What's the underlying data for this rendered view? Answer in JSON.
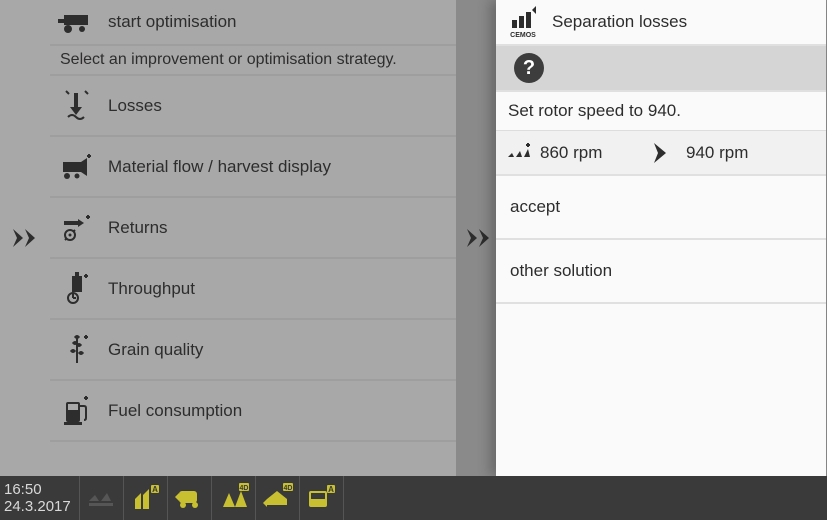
{
  "left": {
    "header_label": "start optimisation",
    "instruction": "Select an improvement or optimisation strategy.",
    "items": [
      {
        "label": "Losses"
      },
      {
        "label": "Material flow / harvest display"
      },
      {
        "label": "Returns"
      },
      {
        "label": "Throughput"
      },
      {
        "label": "Grain quality"
      },
      {
        "label": "Fuel consumption"
      }
    ]
  },
  "right": {
    "header_label": "Separation losses",
    "header_sub": "CEMOS",
    "instruction": "Set rotor speed to 940.",
    "rpm_current": "860 rpm",
    "rpm_target": "940 rpm",
    "actions": {
      "accept": "accept",
      "other": "other solution"
    }
  },
  "bottombar": {
    "time": "16:50",
    "date": "24.3.2017"
  },
  "colors": {
    "accent": "#c8c030",
    "dark": "#2d2d2d"
  }
}
